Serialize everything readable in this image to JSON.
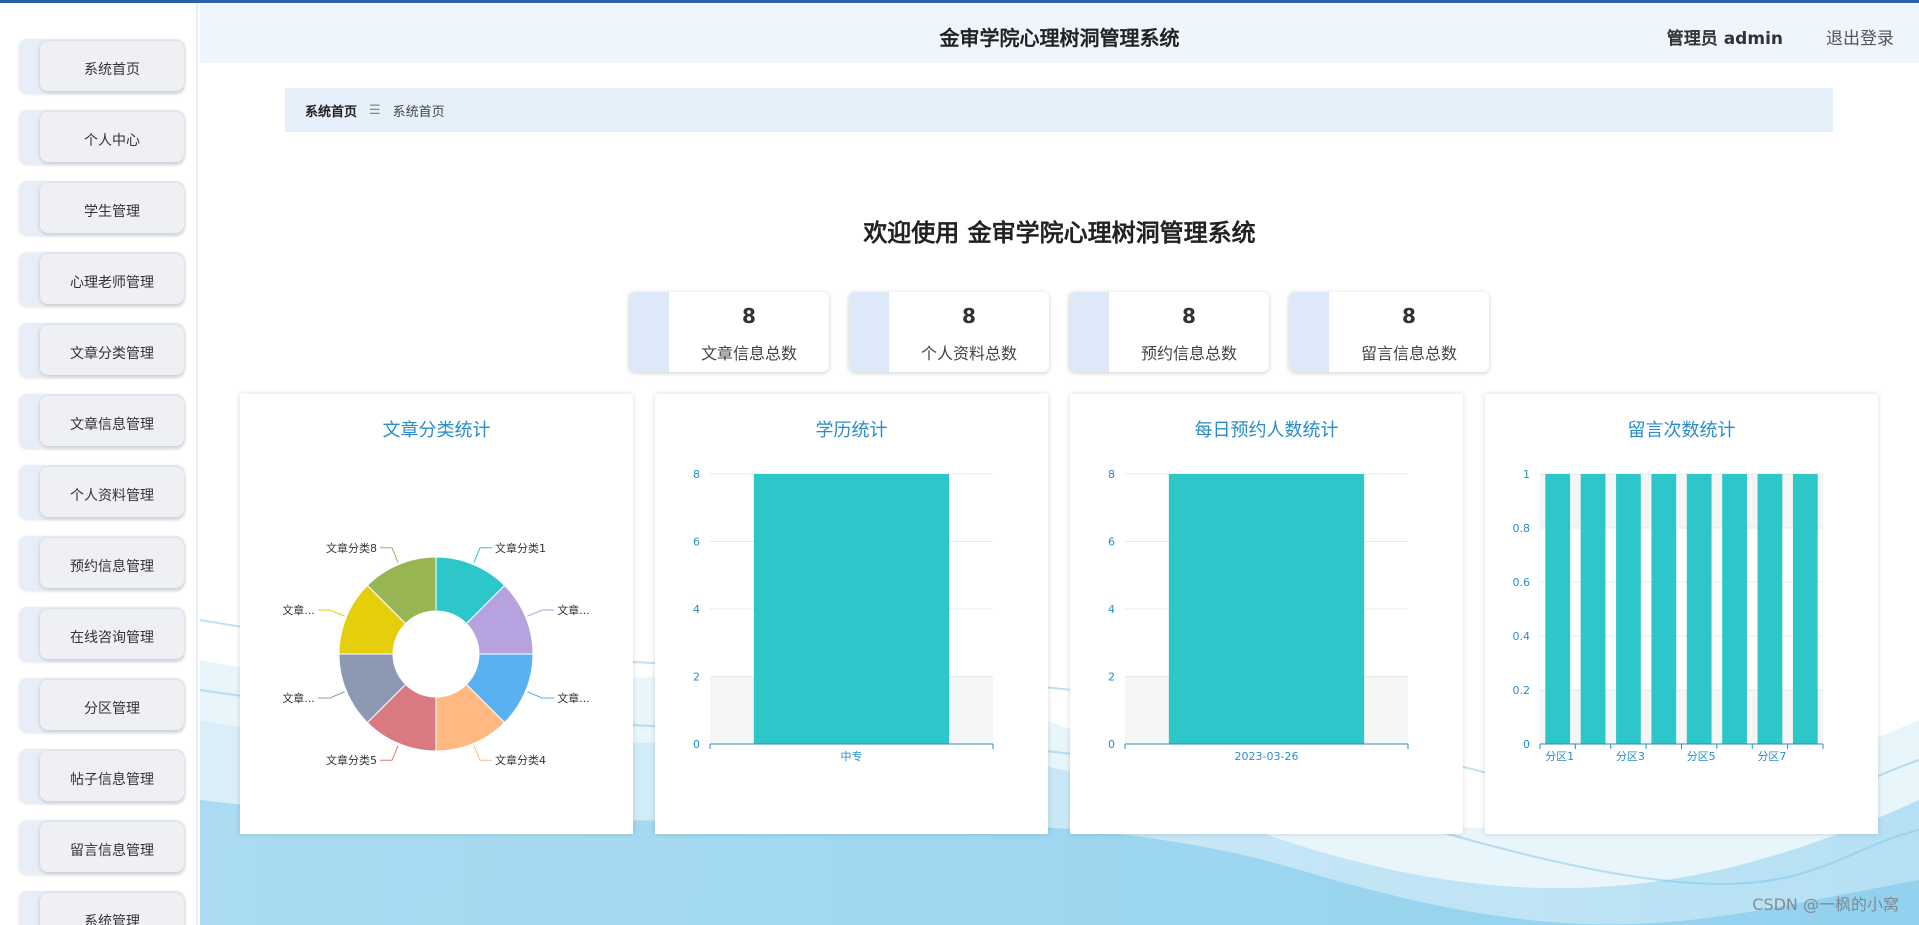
{
  "header": {
    "title": "金审学院心理树洞管理系统",
    "user": "管理员 admin",
    "logout": "退出登录"
  },
  "sidebar": {
    "items": [
      {
        "label": "系统首页"
      },
      {
        "label": "个人中心"
      },
      {
        "label": "学生管理"
      },
      {
        "label": "心理老师管理"
      },
      {
        "label": "文章分类管理"
      },
      {
        "label": "文章信息管理"
      },
      {
        "label": "个人资料管理"
      },
      {
        "label": "预约信息管理"
      },
      {
        "label": "在线咨询管理"
      },
      {
        "label": "分区管理"
      },
      {
        "label": "帖子信息管理"
      },
      {
        "label": "留言信息管理"
      },
      {
        "label": "系统管理"
      }
    ]
  },
  "breadcrumb": {
    "home": "系统首页",
    "separator": "☰",
    "current": "系统首页"
  },
  "welcome": "欢迎使用 金审学院心理树洞管理系统",
  "stats": [
    {
      "value": "8",
      "label": "文章信息总数"
    },
    {
      "value": "8",
      "label": "个人资料总数"
    },
    {
      "value": "8",
      "label": "预约信息总数"
    },
    {
      "value": "8",
      "label": "留言信息总数"
    }
  ],
  "chart_data": [
    {
      "type": "pie",
      "title": "文章分类统计",
      "categories": [
        "文章分类1",
        "文章...",
        "文章...",
        "文章分类4",
        "文章分类5",
        "文章...",
        "文章...",
        "文章分类8"
      ],
      "values": [
        1,
        1,
        1,
        1,
        1,
        1,
        1,
        1
      ],
      "colors": [
        "#2ec7c9",
        "#b6a2de",
        "#5ab1ef",
        "#ffb980",
        "#d87a80",
        "#8d98b3",
        "#e5cf0d",
        "#97b552"
      ]
    },
    {
      "type": "bar",
      "title": "学历统计",
      "categories": [
        "中专"
      ],
      "values": [
        8
      ],
      "ylim": [
        0,
        8
      ],
      "yticks": [
        0,
        2,
        4,
        6,
        8
      ],
      "color": "#2ec7c9"
    },
    {
      "type": "bar",
      "title": "每日预约人数统计",
      "categories": [
        "2023-03-26"
      ],
      "values": [
        8
      ],
      "ylim": [
        0,
        8
      ],
      "yticks": [
        0,
        2,
        4,
        6,
        8
      ],
      "color": "#2ec7c9"
    },
    {
      "type": "bar",
      "title": "留言次数统计",
      "categories": [
        "分区1",
        "分区2",
        "分区3",
        "分区4",
        "分区5",
        "分区6",
        "分区7",
        "分区8"
      ],
      "shown_tick_labels": [
        "分区1",
        "分区3",
        "分区5",
        "分区7"
      ],
      "values": [
        1,
        1,
        1,
        1,
        1,
        1,
        1,
        1
      ],
      "ylim": [
        0,
        1
      ],
      "yticks": [
        0,
        0.2,
        0.4,
        0.6,
        0.8,
        1
      ],
      "color": "#2ec7c9"
    }
  ],
  "watermark": "CSDN @一枫的小窝"
}
